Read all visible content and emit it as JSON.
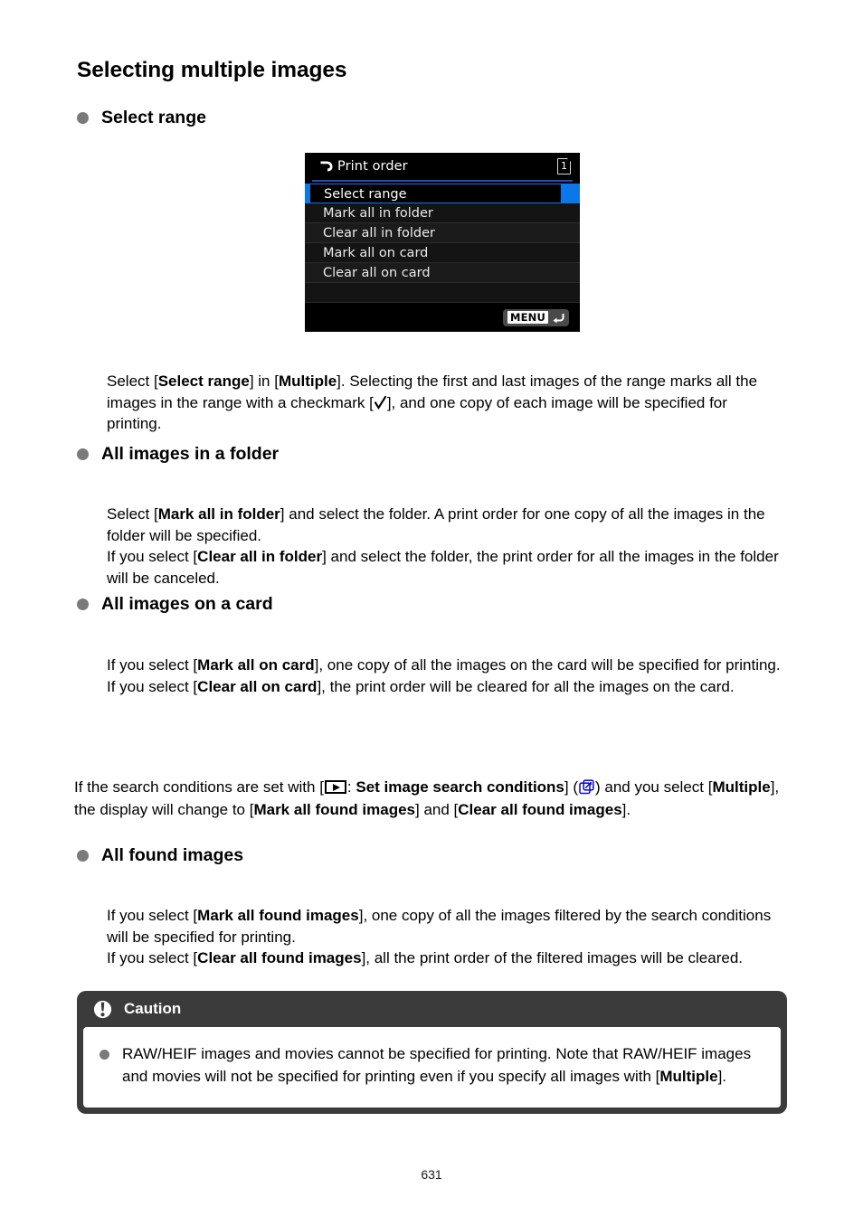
{
  "page": {
    "title": "Selecting multiple images",
    "number": "631"
  },
  "camera_screen": {
    "title": "Print order",
    "print_icon": "print-order-icon",
    "card_slot_badge": "1",
    "menu_button_label": "MENU",
    "menu_return_icon": "return-arrow-icon",
    "rows": [
      {
        "label": "Select range",
        "selected": true
      },
      {
        "label": "Mark all in folder",
        "selected": false
      },
      {
        "label": "Clear all in folder",
        "selected": false
      },
      {
        "label": "Mark all on card",
        "selected": false
      },
      {
        "label": "Clear all on card",
        "selected": false
      }
    ],
    "colors": {
      "highlight": "#0a78e8",
      "title_underline": "#1f4fb0",
      "background": "#000000"
    }
  },
  "sections": {
    "select_range": {
      "heading": "Select range",
      "paragraph_part1": "Select [",
      "bold1": "Select range",
      "paragraph_part2": "] in [",
      "bold2": "Multiple",
      "paragraph_part3": "]. Selecting the first and last images of the range marks all the images in the range with a checkmark [",
      "checkmark_icon": "checkmark-icon",
      "paragraph_part4": "], and one copy of each image will be specified for printing."
    },
    "all_images_in_folder": {
      "heading": "All images in a folder",
      "line1_part1": "Select [",
      "line1_bold": "Mark all in folder",
      "line1_part2": "] and select the folder. A print order for one copy of all the images in the folder will be specified.",
      "line2_part1": "If you select [",
      "line2_bold": "Clear all in folder",
      "line2_part2": "] and select the folder, the print order for all the images in the folder will be canceled."
    },
    "all_images_on_card": {
      "heading": "All images on a card",
      "line1_part1": "If you select [",
      "line1_bold": "Mark all on card",
      "line1_part2": "], one copy of all the images on the card will be specified for printing.",
      "line2_part1": "If you select [",
      "line2_bold": "Clear all on card",
      "line2_part2": "], the print order will be cleared for all the images on the card."
    },
    "search_conditions": {
      "part1": "If the search conditions are set with [",
      "playback_icon": "playback-menu-icon",
      "part2": ": ",
      "bold1": "Set image search conditions",
      "part3": "] (",
      "link_icon": "page-link-icon",
      "part4": ") and you select [",
      "bold2": "Multiple",
      "part5": "], the display will change to [",
      "bold3": "Mark all found images",
      "part6": "] and [",
      "bold4": "Clear all found images",
      "part7": "]."
    },
    "all_found_images": {
      "heading": "All found images",
      "line1_part1": "If you select [",
      "line1_bold": "Mark all found images",
      "line1_part2": "], one copy of all the images filtered by the search conditions will be specified for printing.",
      "line2_part1": "If you select [",
      "line2_bold": "Clear all found images",
      "line2_part2": "], all the print order of the filtered images will be cleared."
    }
  },
  "caution": {
    "icon": "caution-exclamation-icon",
    "title": "Caution",
    "item_part1": "RAW/HEIF images and movies cannot be specified for printing. Note that RAW/HEIF images and movies will not be specified for printing even if you specify all images with [",
    "item_bold": "Multiple",
    "item_part2": "]."
  }
}
